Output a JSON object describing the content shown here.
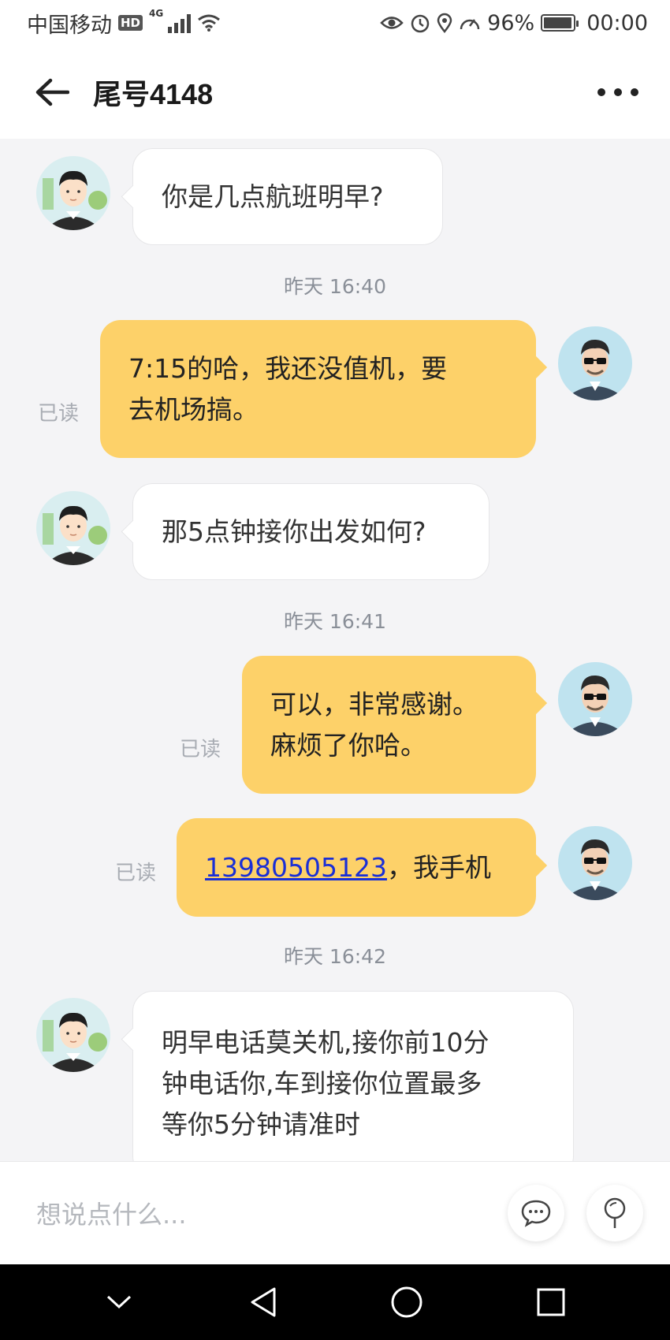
{
  "status_bar": {
    "carrier": "中国移动",
    "hd": "HD",
    "network": "4G",
    "battery": "96%",
    "battery_level": 0.96,
    "time": "00:00"
  },
  "header": {
    "title": "尾号4148"
  },
  "messages": [
    {
      "side": "in",
      "text": "你是几点航班明早?"
    },
    {
      "type": "time",
      "text": "昨天 16:40"
    },
    {
      "side": "out",
      "lines": [
        "7:15的哈，我还没值机，要",
        "去机场搞。"
      ],
      "read": "已读"
    },
    {
      "side": "in",
      "text": "那5点钟接你出发如何?"
    },
    {
      "type": "time",
      "text": "昨天 16:41"
    },
    {
      "side": "out",
      "lines": [
        "可以，非常感谢。",
        "麻烦了你哈。"
      ],
      "read": "已读"
    },
    {
      "side": "out",
      "phone": "13980505123",
      "suffix": "，我手机",
      "read": "已读"
    },
    {
      "type": "time",
      "text": "昨天 16:42"
    },
    {
      "side": "in",
      "lines": [
        "明早电话莫关机,接你前10分",
        "钟电话你,车到接你位置最多",
        "等你5分钟请准时"
      ]
    }
  ],
  "input": {
    "placeholder": "想说点什么..."
  },
  "colors": {
    "outgoing_bubble": "#fdd169",
    "incoming_bubble": "#ffffff",
    "link": "#1a2fd6"
  },
  "icons": [
    "back-arrow-icon",
    "more-icon",
    "quick-reply-icon",
    "location-pin-icon",
    "nav-back-icon",
    "nav-home-icon",
    "nav-recents-icon"
  ]
}
